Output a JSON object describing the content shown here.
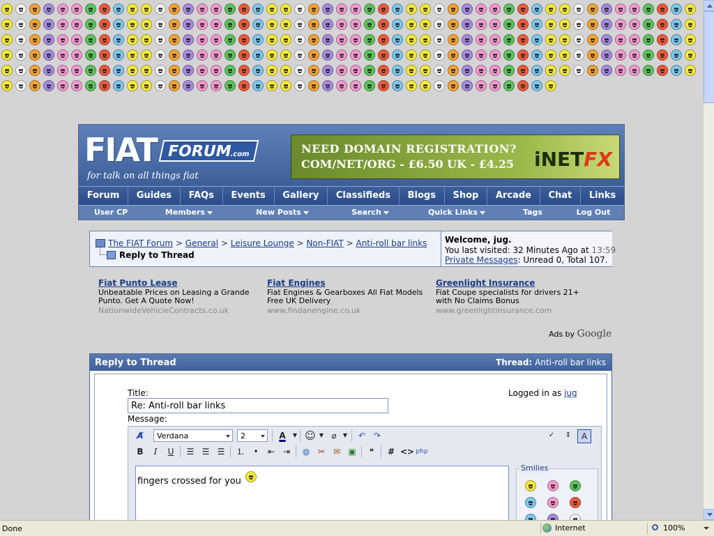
{
  "smilies_strip": {
    "count": 290,
    "palette": [
      "#f6ea3c",
      "#7cc8f0",
      "#ee5a3a",
      "#5cc45c",
      "#f49ad0",
      "#a78ae0",
      "#f7a433",
      "#f4f4f4"
    ]
  },
  "site": {
    "logo": {
      "fiat": "FIAT",
      "forum": "FORUM",
      "domain": ".com",
      "tagline": "for talk on all things fiat"
    },
    "banner": {
      "line1": "NEED DOMAIN REGISTRATION?",
      "line2": "COM/NET/ORG - £6.50   UK - £4.25",
      "brand_a": "iNET",
      "brand_b": "FX"
    },
    "nav": [
      "Forum",
      "Guides",
      "FAQs",
      "Events",
      "Gallery",
      "Classifieds",
      "Blogs",
      "Shop",
      "Arcade",
      "Chat",
      "Links"
    ],
    "subnav": [
      {
        "label": "User CP",
        "menu": false
      },
      {
        "label": "Members",
        "menu": true
      },
      {
        "label": "New Posts",
        "menu": true
      },
      {
        "label": "Search",
        "menu": true
      },
      {
        "label": "Quick Links",
        "menu": true
      },
      {
        "label": "Tags",
        "menu": false
      },
      {
        "label": "Log Out",
        "menu": false
      }
    ]
  },
  "breadcrumb": {
    "items": [
      "The FIAT Forum",
      "General",
      "Leisure Lounge",
      "Non-FIAT",
      "Anti-roll bar links"
    ],
    "separator": ">",
    "current": "Reply to Thread"
  },
  "welcome": {
    "greeting": "Welcome, jug.",
    "last_visited_prefix": "You last visited: 32 Minutes Ago at",
    "last_visited_time": "13:59",
    "pm_link": "Private Messages",
    "pm_counts": ": Unread 0, Total 107."
  },
  "ads": [
    {
      "title": "Fiat Punto Lease",
      "desc": "Unbeatable Prices on Leasing a Grande Punto. Get A Quote Now!",
      "url": "NationwideVehicleContracts.co.uk"
    },
    {
      "title": "Fiat Engines",
      "desc": "Fiat Engines & Gearboxes All Fiat Models Free UK Delivery",
      "url": "www.findanengine.co.uk"
    },
    {
      "title": "Greenlight Insurance",
      "desc": "Fiat Coupe specialists for drivers 21+ with No Claims Bonus",
      "url": "www.greenlightinsurance.com"
    }
  ],
  "ads_by": {
    "prefix": "Ads by",
    "brand": "Google"
  },
  "reply": {
    "heading": "Reply to Thread",
    "thread_label": "Thread:",
    "thread_name": "Anti-roll bar links",
    "title_label": "Title:",
    "title_value": "Re: Anti-roll bar links",
    "logged_in_prefix": "Logged in as",
    "logged_in_user": "jug",
    "message_label": "Message:"
  },
  "editor": {
    "font": "Verdana",
    "size": "2",
    "message_text": "fingers crossed for you",
    "smilies_label": "Smilies",
    "smilies": [
      "c-yellow",
      "c-pink",
      "c-green",
      "c-blue",
      "c-pink",
      "c-red",
      "c-blue",
      "c-purple",
      "c-white"
    ]
  },
  "statusbar": {
    "status": "Done",
    "zone": "Internet",
    "zoom": "100%"
  }
}
